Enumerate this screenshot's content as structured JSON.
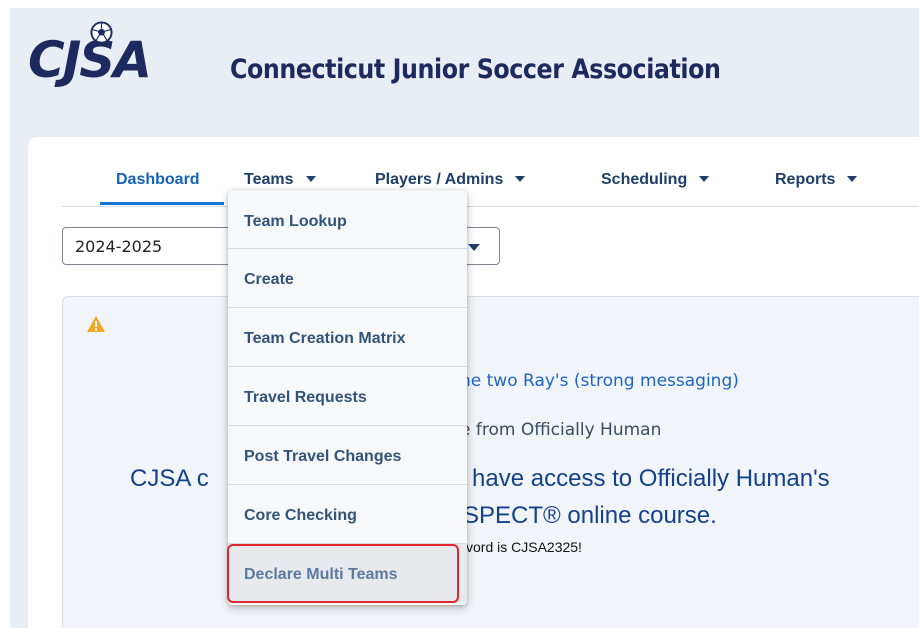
{
  "header": {
    "logo_text": "CJSA",
    "site_title": "Connecticut Junior Soccer Association"
  },
  "nav": {
    "items": [
      {
        "label": "Dashboard",
        "active": true
      },
      {
        "label": "Teams",
        "has_dropdown": true
      },
      {
        "label": "Players / Admins",
        "has_dropdown": true
      },
      {
        "label": "Scheduling",
        "has_dropdown": true
      },
      {
        "label": "Reports",
        "has_dropdown": true
      }
    ]
  },
  "season_select": {
    "value": "2024-2025"
  },
  "teams_menu": {
    "items": [
      {
        "label": "Team Lookup"
      },
      {
        "label": "Create"
      },
      {
        "label": "Team Creation Matrix"
      },
      {
        "label": "Travel Requests"
      },
      {
        "label": "Post Travel Changes"
      },
      {
        "label": "Core Checking"
      },
      {
        "label": "Declare Multi Teams",
        "highlighted": true
      }
    ]
  },
  "announcement": {
    "line1": "he two Ray's (strong messaging)",
    "line2": "e from Officially Human",
    "line3a": "CJSA c",
    "line3b": "; have access to Officially Human's",
    "line4": "SPECT® online course.",
    "line5": "vord is CJSA2325!"
  },
  "colors": {
    "brand_navy": "#1c2a5f",
    "active_tab": "#1562b8",
    "highlight_border": "#e0272f",
    "warning": "#f5a623"
  }
}
